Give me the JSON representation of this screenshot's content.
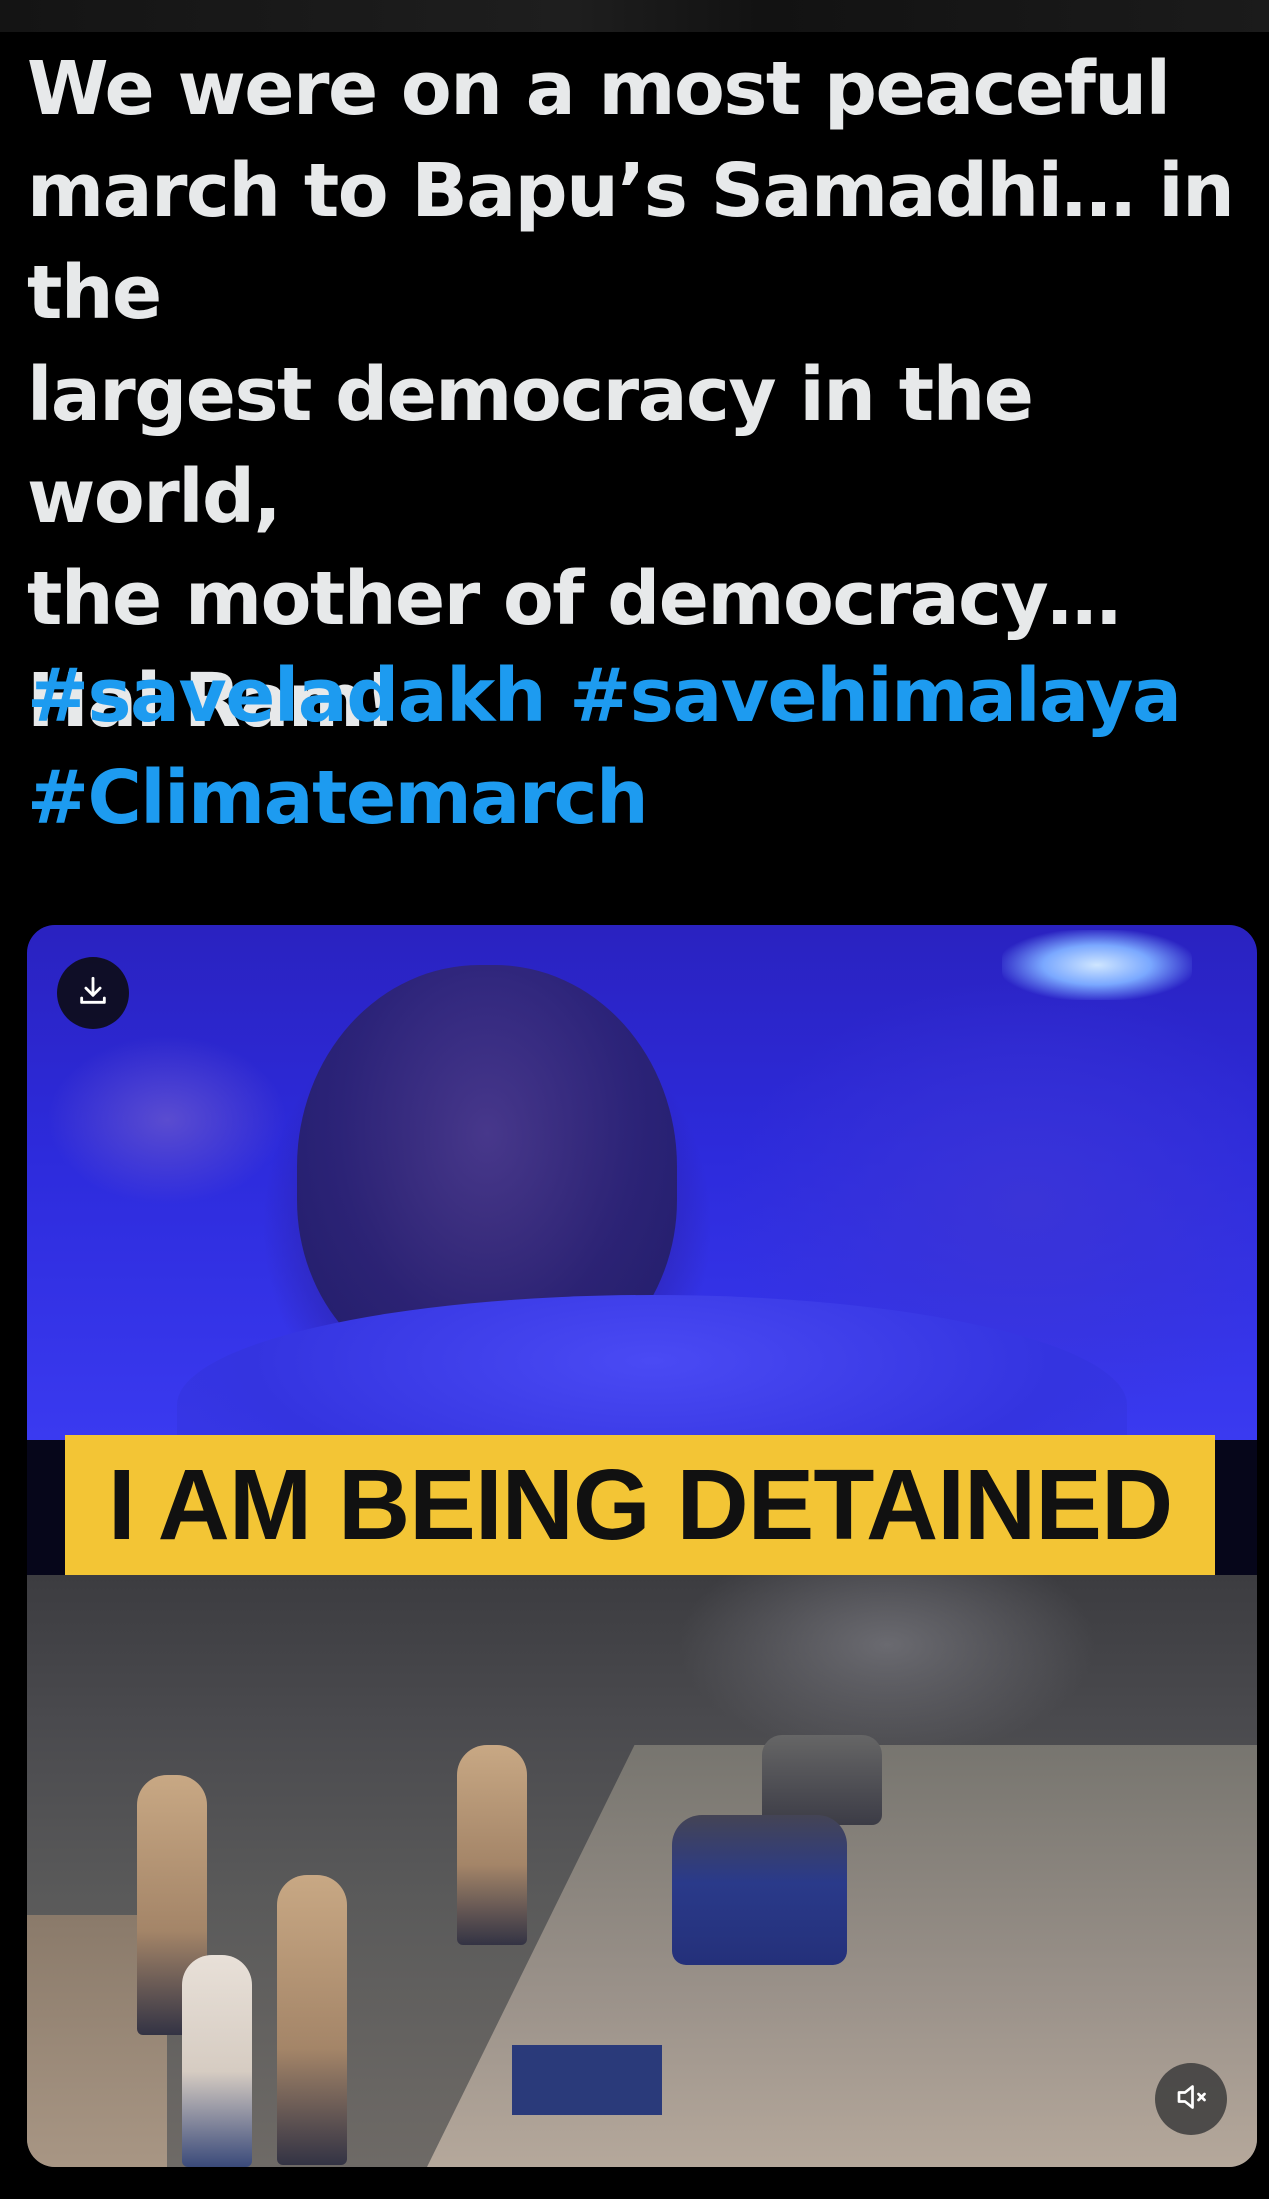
{
  "tweet": {
    "text": "We were on a most peaceful\nmarch to Bapu’s Samadhi… in the\nlargest democracy in the world,\nthe mother of democracy…\nHai Ram!",
    "hashtags": [
      "#saveladakh",
      "#savehimalaya",
      "#Climatemarch"
    ]
  },
  "media": {
    "type": "video",
    "caption_overlay": "I AM BEING DETAINED",
    "download_icon": "download-icon",
    "mute_icon": "volume-muted-icon"
  },
  "colors": {
    "background": "#000000",
    "text": "#e7e9ea",
    "hashtag": "#1d9bf0",
    "caption_bar": "#f3c535"
  }
}
